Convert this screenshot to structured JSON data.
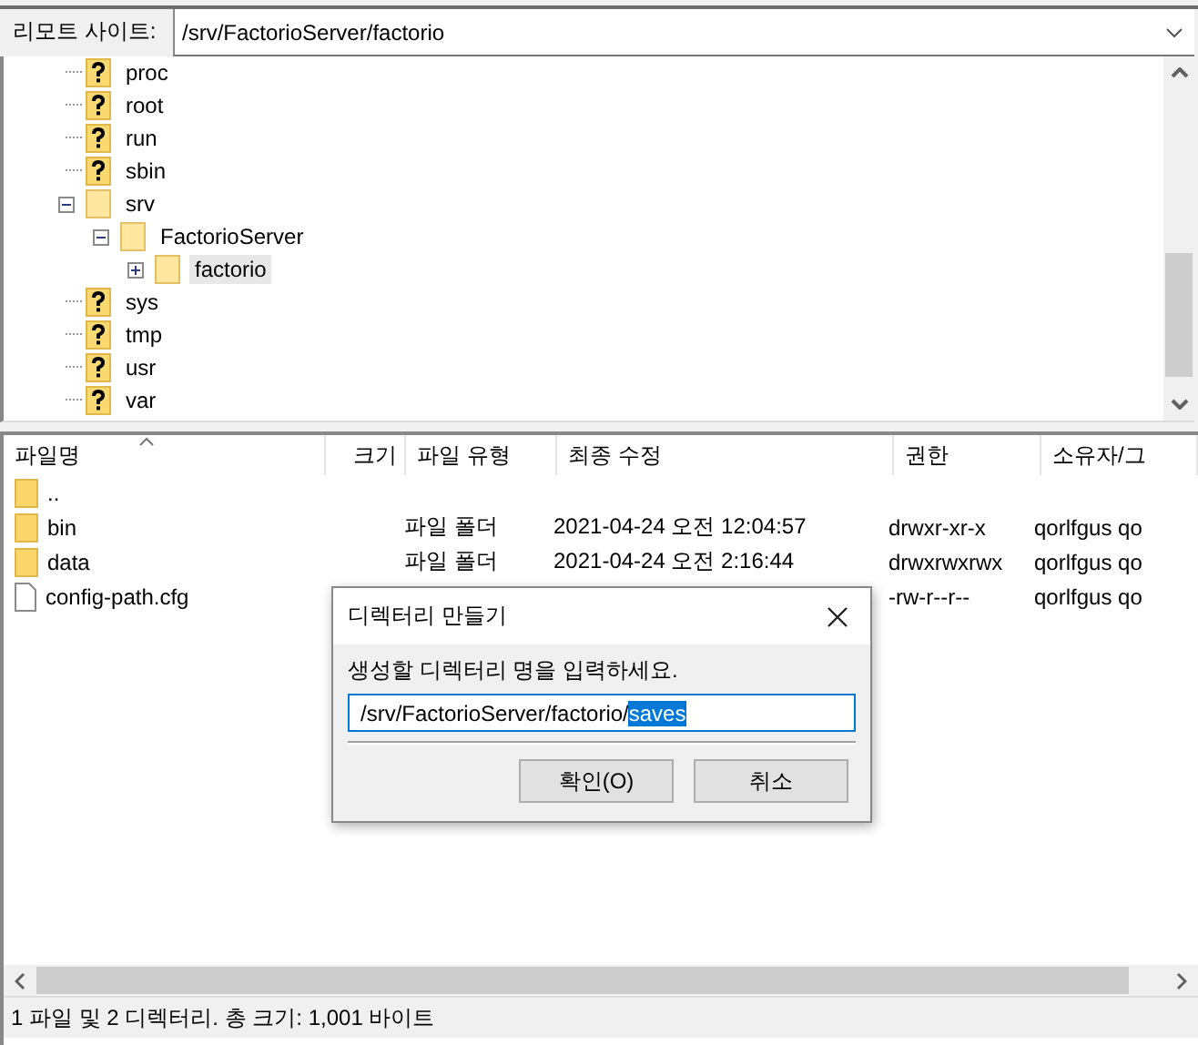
{
  "remote_site": {
    "label": "리모트 사이트:",
    "path": "/srv/FactorioServer/factorio"
  },
  "tree": [
    {
      "name": "proc",
      "kind": "unknown",
      "selected": false
    },
    {
      "name": "root",
      "kind": "unknown",
      "selected": false
    },
    {
      "name": "run",
      "kind": "unknown",
      "selected": false
    },
    {
      "name": "sbin",
      "kind": "unknown",
      "selected": false
    },
    {
      "name": "srv",
      "kind": "folder",
      "selected": false,
      "expanded": true,
      "children": [
        {
          "name": "FactorioServer",
          "kind": "folder",
          "selected": false,
          "expanded": true,
          "children": [
            {
              "name": "factorio",
              "kind": "folder",
              "selected": true,
              "expanded": false
            }
          ]
        }
      ]
    },
    {
      "name": "sys",
      "kind": "unknown",
      "selected": false
    },
    {
      "name": "tmp",
      "kind": "unknown",
      "selected": false
    },
    {
      "name": "usr",
      "kind": "unknown",
      "selected": false
    },
    {
      "name": "var",
      "kind": "unknown",
      "selected": false
    }
  ],
  "table": {
    "columns": [
      "파일명",
      "크기",
      "파일 유형",
      "최종 수정",
      "권한",
      "소유자/그"
    ],
    "rows": [
      {
        "kind": "folder",
        "name": ".."
      },
      {
        "kind": "folder",
        "name": "bin",
        "type": "파일 폴더",
        "modified": "2021-04-24 오전 12:04:57",
        "permissions": "drwxr-xr-x",
        "owner": "qorlfgus qo"
      },
      {
        "kind": "folder",
        "name": "data",
        "type": "파일 폴더",
        "modified": "2021-04-24 오전 2:16:44",
        "permissions": "drwxrwxrwx",
        "owner": "qorlfgus qo"
      },
      {
        "kind": "file",
        "name": "config-path.cfg",
        "permissions": "-rw-r--r--",
        "owner": "qorlfgus qo"
      }
    ]
  },
  "status_bar": "1 파일 및 2 디렉터리. 총 크기: 1,001 바이트",
  "dialog": {
    "title": "디렉터리 만들기",
    "prompt": "생성할 디렉터리 명을 입력하세요.",
    "value": "/srv/FactorioServer/factorio/",
    "selected_text": "saves",
    "buttons": [
      "확인(O)",
      "취소"
    ]
  }
}
